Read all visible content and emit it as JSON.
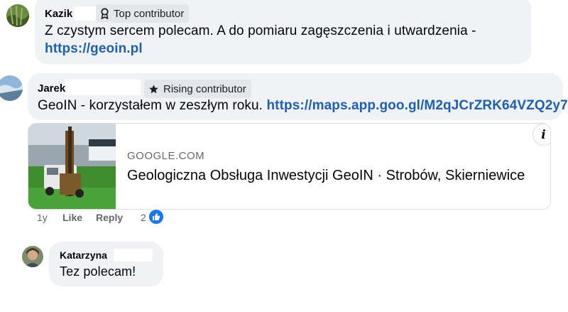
{
  "comments": [
    {
      "author": "Kazik",
      "badge": "Top contributor",
      "badge_icon": "award-ribbon-icon",
      "text": "Z czystym sercem polecam. A do pomiaru zagęszczenia i utwardzenia -",
      "link": "https://geoin.pl"
    },
    {
      "author": "Jarek",
      "badge": "Rising contributor",
      "badge_icon": "star-icon",
      "text": "GeoIN - korzystałem w zeszłym roku.",
      "link": "https://maps.app.goo.gl/M2qJCrZRK64VZQ2y7...",
      "preview": {
        "domain": "GOOGLE.COM",
        "title": "Geologiczna Obsługa Inwestycji GeoIN · Strobów, Skierniewice",
        "info_icon": "i"
      },
      "actions": {
        "time": "1y",
        "like": "Like",
        "reply": "Reply",
        "reaction_count": "2"
      }
    },
    {
      "author": "Katarzyna",
      "text": "Tez polecam!"
    }
  ],
  "colors": {
    "bubble": "#f0f2f5",
    "link": "#1f5fb3",
    "like_blue": "#1877f2",
    "meta_gray": "#65676b"
  }
}
